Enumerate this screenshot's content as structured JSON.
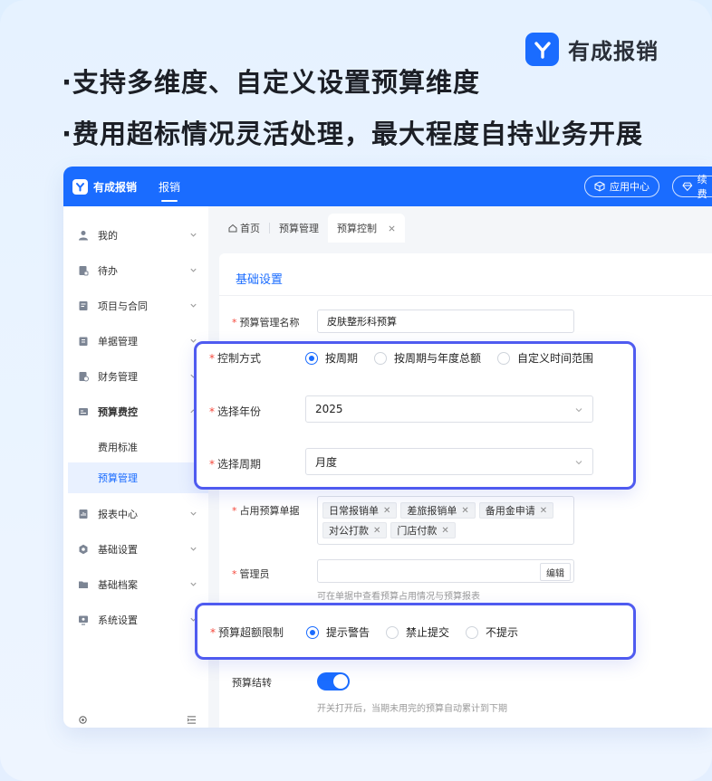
{
  "brand": {
    "name": "有成报销",
    "color": "#1a6cff"
  },
  "headlines": [
    "·支持多维度、自定义设置预算维度",
    "·费用超标情况灵活处理，最大程度自持业务开展"
  ],
  "app": {
    "topbar": {
      "brand": "有成报销",
      "nav": "报销",
      "app_center": "应用中心",
      "renew": "续费"
    },
    "sidebar": {
      "items": [
        {
          "label": "我的",
          "icon": "user-icon"
        },
        {
          "label": "待办",
          "icon": "todo-icon"
        },
        {
          "label": "项目与合同",
          "icon": "contract-icon"
        },
        {
          "label": "单据管理",
          "icon": "document-icon"
        },
        {
          "label": "财务管理",
          "icon": "finance-icon"
        },
        {
          "label": "预算费控",
          "icon": "budget-icon"
        },
        {
          "label": "报表中心",
          "icon": "report-icon"
        },
        {
          "label": "基础设置",
          "icon": "gear-icon"
        },
        {
          "label": "基础档案",
          "icon": "folder-icon"
        },
        {
          "label": "系统设置",
          "icon": "monitor-icon"
        }
      ],
      "sub_items": [
        "费用标准",
        "预算管理"
      ]
    },
    "tabs": {
      "home": "首页",
      "t1": "预算管理",
      "t2": "预算控制"
    },
    "form": {
      "section_title": "基础设置",
      "budget_name_label": "预算管理名称",
      "budget_name_value": "皮肤整形科预算",
      "control_mode_label": "控制方式",
      "control_mode_options": [
        "按周期",
        "按周期与年度总额",
        "自定义时间范围"
      ],
      "year_label": "选择年份",
      "year_value": "2025",
      "period_label": "选择周期",
      "period_value": "月度",
      "docs_label": "占用预算单据",
      "docs_tags": [
        "日常报销单",
        "差旅报销单",
        "备用金申请",
        "对公打款",
        "门店付款"
      ],
      "admin_label": "管理员",
      "admin_edit": "编辑",
      "admin_hint": "可在单据中查看预算占用情况与预算报表",
      "overlimit_label": "预算超额限制",
      "overlimit_options": [
        "提示警告",
        "禁止提交",
        "不提示"
      ],
      "carryover_label": "预算结转",
      "carryover_hint": "开关打开后，当期未用完的预算自动累计到下期"
    }
  }
}
